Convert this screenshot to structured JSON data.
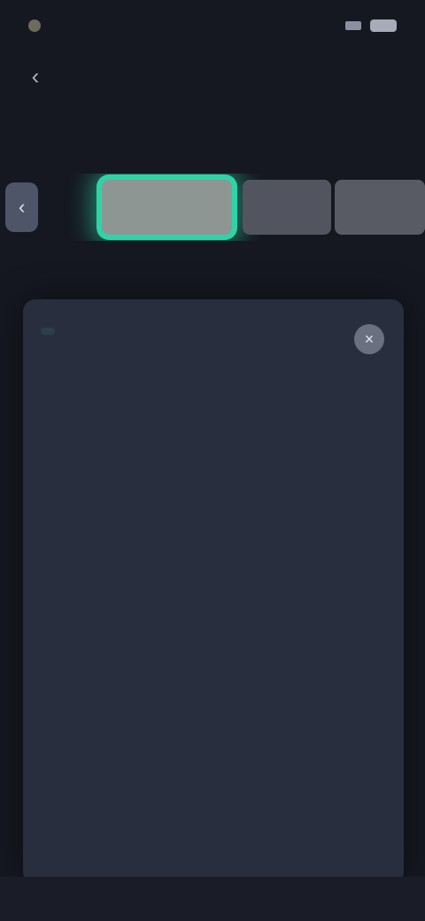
{
  "status_bar": {
    "time": "",
    "battery": ""
  },
  "header": {
    "title": "",
    "back_glyph": "‹"
  },
  "subtitle": "",
  "tabs": {
    "nav_glyph": "‹",
    "items": [
      {
        "label": ""
      },
      {
        "label": "",
        "active": true
      },
      {
        "label": ""
      },
      {
        "label": ""
      }
    ]
  },
  "card": {
    "tag": "",
    "close_glyph": "×",
    "paragraphs": [
      "",
      "",
      "",
      ""
    ]
  },
  "colors": {
    "background": "#151821",
    "card": "#292e3e",
    "accent": "#2fd4a6",
    "active_tab": "#8e9694"
  }
}
